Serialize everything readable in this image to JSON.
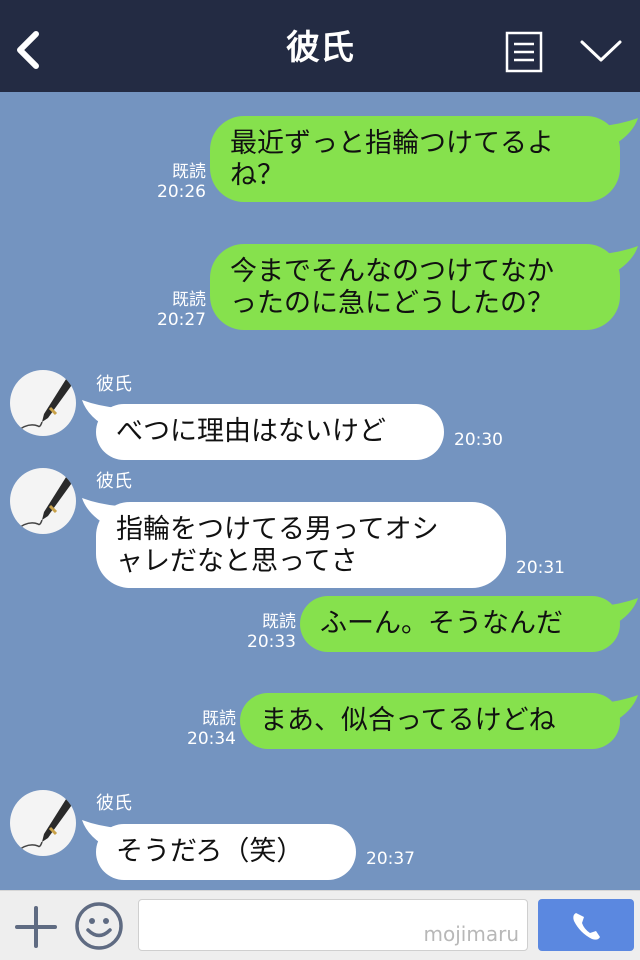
{
  "header": {
    "title": "彼氏"
  },
  "messages": [
    {
      "side": "out",
      "lines": [
        "最近ずっと指輪つけてるよ",
        "ね？"
      ],
      "read": "既読",
      "time": "20:26"
    },
    {
      "side": "out",
      "lines": [
        "今までそんなのつけてなか",
        "ったのに急にどうしたの？"
      ],
      "read": "既読",
      "time": "20:27"
    },
    {
      "side": "in",
      "name": "彼氏",
      "lines": [
        "べつに理由はないけど"
      ],
      "time": "20:30"
    },
    {
      "side": "in",
      "name": "彼氏",
      "lines": [
        "指輪をつけてる男ってオシ",
        "ャレだなと思ってさ"
      ],
      "time": "20:31"
    },
    {
      "side": "out",
      "lines": [
        "ふーん。そうなんだ"
      ],
      "read": "既読",
      "time": "20:33"
    },
    {
      "side": "out",
      "lines": [
        "まあ、似合ってるけどね"
      ],
      "read": "既読",
      "time": "20:34"
    },
    {
      "side": "in",
      "name": "彼氏",
      "lines": [
        "そうだろ（笑）"
      ],
      "time": "20:37"
    }
  ],
  "input": {
    "watermark": "mojimaru"
  },
  "icons": {
    "back": "chevron-left-icon",
    "menu": "menu-list-icon",
    "collapse": "chevron-down-icon",
    "add": "plus-icon",
    "emoji": "smiley-icon",
    "call": "phone-icon",
    "avatar": "fountain-pen-icon"
  },
  "colors": {
    "header_bg": "#232b43",
    "chat_bg": "#7494c0",
    "outgoing_bubble": "#86e14d",
    "incoming_bubble": "#ffffff",
    "call_button": "#5b88e0"
  }
}
